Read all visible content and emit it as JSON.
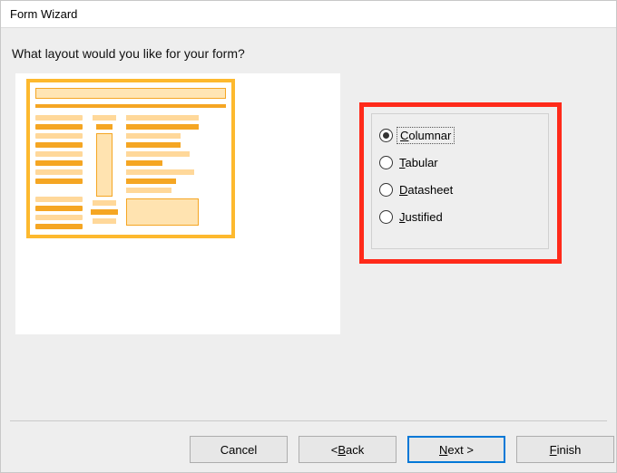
{
  "title": "Form Wizard",
  "prompt": "What layout would you like for your form?",
  "options": {
    "columnar": {
      "prefix": "C",
      "rest": "olumnar",
      "selected": true
    },
    "tabular": {
      "prefix": "T",
      "rest": "abular",
      "selected": false
    },
    "datasheet": {
      "prefix": "D",
      "rest": "atasheet",
      "selected": false
    },
    "justified": {
      "prefix": "J",
      "rest": "ustified",
      "selected": false
    }
  },
  "buttons": {
    "cancel": "Cancel",
    "back": {
      "lead": "< ",
      "prefix": "B",
      "rest": "ack"
    },
    "next": {
      "prefix": "N",
      "rest": "ext >",
      "primary": true
    },
    "finish": {
      "prefix": "F",
      "rest": "inish"
    }
  }
}
